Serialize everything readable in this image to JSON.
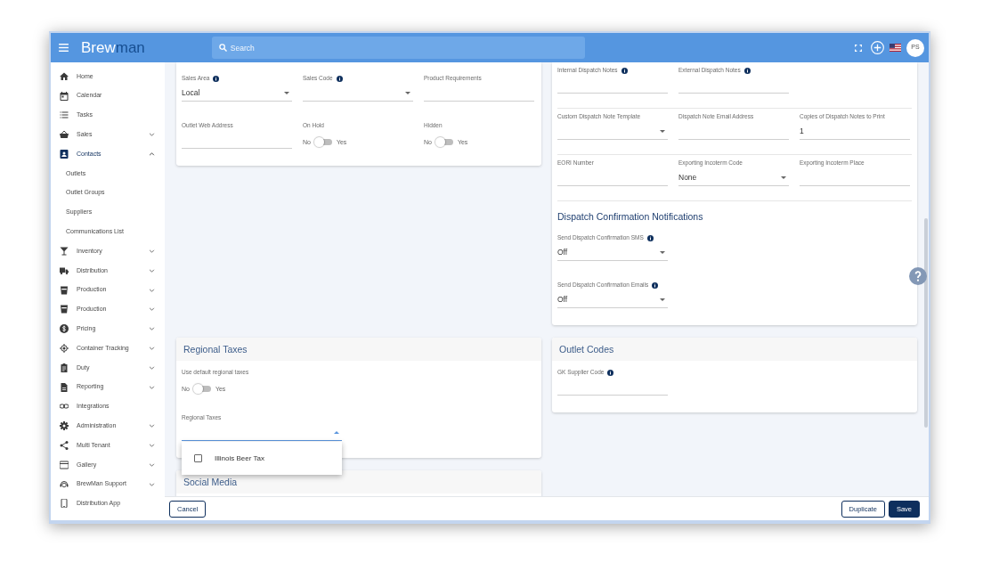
{
  "topbar": {
    "logo": {
      "part_1": "Brew",
      "part_2": "man"
    },
    "search": {
      "placeholder": "Search"
    },
    "avatar": "PS"
  },
  "sidebar": {
    "items": [
      {
        "label": "Home",
        "expandable": false,
        "selected": false
      },
      {
        "label": "Calendar",
        "expandable": false,
        "selected": false
      },
      {
        "label": "Tasks",
        "expandable": false,
        "selected": false
      },
      {
        "label": "Sales",
        "expandable": true,
        "expanded": false,
        "selected": false
      },
      {
        "label": "Contacts",
        "expandable": true,
        "expanded": true,
        "selected": true,
        "children": [
          {
            "label": "Outlets",
            "selected": false
          },
          {
            "label": "Outlet Groups",
            "selected": false
          },
          {
            "label": "Suppliers",
            "selected": false
          },
          {
            "label": "Communications List",
            "selected": false
          }
        ]
      },
      {
        "label": "Inventory",
        "expandable": true,
        "expanded": false,
        "selected": false
      },
      {
        "label": "Distribution",
        "expandable": true,
        "expanded": false,
        "selected": false
      },
      {
        "label": "Production",
        "expandable": true,
        "expanded": false,
        "selected": false
      },
      {
        "label": "Production",
        "expandable": true,
        "expanded": false,
        "selected": false
      },
      {
        "label": "Pricing",
        "expandable": true,
        "expanded": false,
        "selected": false
      },
      {
        "label": "Container Tracking",
        "expandable": true,
        "expanded": false,
        "selected": false
      },
      {
        "label": "Duty",
        "expandable": true,
        "expanded": false,
        "selected": false
      },
      {
        "label": "Reporting",
        "expandable": true,
        "expanded": false,
        "selected": false
      },
      {
        "label": "Integrations",
        "expandable": false,
        "selected": false
      },
      {
        "label": "Administration",
        "expandable": true,
        "expanded": false,
        "selected": false
      },
      {
        "label": "Multi Tenant",
        "expandable": true,
        "expanded": false,
        "selected": false
      },
      {
        "label": "Gallery",
        "expandable": true,
        "expanded": false,
        "selected": false
      },
      {
        "label": "BrewMan Support",
        "expandable": true,
        "expanded": false,
        "selected": false
      },
      {
        "label": "Distribution App",
        "expandable": false,
        "selected": false
      }
    ]
  },
  "form": {
    "left_column": [
      {
        "sections": [
          {
            "divided": false,
            "rows": [
              [
                {
                  "kind": "select",
                  "label": "Sales Area",
                  "info": true,
                  "value": "Local",
                  "open": false
                },
                {
                  "kind": "select",
                  "label": "Sales Code",
                  "info": true,
                  "open": false
                },
                {
                  "kind": "input",
                  "label": "Product Requirements",
                  "info": false
                }
              ],
              [
                {
                  "kind": "input",
                  "label": "Outlet Web Address",
                  "info": false
                },
                {
                  "kind": "toggle",
                  "label": "On Hold",
                  "info": false,
                  "off_label": "No",
                  "on_label": "Yes",
                  "on": false
                },
                {
                  "kind": "toggle",
                  "label": "Hidden",
                  "info": false,
                  "off_label": "No",
                  "on_label": "Yes",
                  "on": false
                }
              ]
            ]
          }
        ]
      },
      {
        "title": "Regional Taxes",
        "sections": [
          {
            "divided": false,
            "rows": [
              [
                {
                  "kind": "toggle",
                  "label": "Use default regional taxes",
                  "info": false,
                  "off_label": "No",
                  "on_label": "Yes",
                  "on": false
                }
              ],
              [
                {
                  "kind": "multiselect",
                  "label": "Regional Taxes",
                  "info": false,
                  "open": true,
                  "options": [
                    {
                      "label": "Illinois Beer Tax",
                      "checked": false
                    }
                  ]
                }
              ]
            ]
          }
        ]
      },
      {
        "title": "Social Media"
      }
    ],
    "right_column": [
      {
        "sections": [
          {
            "divided": true,
            "rows": [
              [
                {
                  "kind": "input",
                  "label": "Internal Dispatch Notes",
                  "info": true
                },
                {
                  "kind": "input",
                  "label": "External Dispatch Notes",
                  "info": true
                }
              ],
              [
                {
                  "kind": "select",
                  "label": "Custom Dispatch Note Template",
                  "info": false,
                  "open": false
                },
                {
                  "kind": "input",
                  "label": "Dispatch Note Email Address",
                  "info": false
                },
                {
                  "kind": "input",
                  "label": "Copies of Dispatch Notes to Print",
                  "info": false,
                  "value": "1"
                }
              ],
              [
                {
                  "kind": "input",
                  "label": "EORI Number",
                  "info": false
                },
                {
                  "kind": "select",
                  "label": "Exporting Incoterm Code",
                  "info": false,
                  "value": "None",
                  "open": false
                },
                {
                  "kind": "input",
                  "label": "Exporting Incoterm Place",
                  "info": false
                }
              ]
            ]
          },
          {
            "heading": "Dispatch Confirmation Notifications",
            "divided": false,
            "rows": [
              [
                {
                  "kind": "select",
                  "label": "Send Dispatch Confirmation SMS",
                  "info": true,
                  "value": "Off",
                  "open": false
                }
              ],
              [
                {
                  "kind": "select",
                  "label": "Send Dispatch Confirmation Emails",
                  "info": true,
                  "value": "Off",
                  "open": false
                }
              ]
            ]
          }
        ]
      },
      {
        "title": "Outlet Codes",
        "sections": [
          {
            "divided": false,
            "rows": [
              [
                {
                  "kind": "input",
                  "label": "GK Supplier Code",
                  "info": true
                }
              ]
            ]
          }
        ]
      }
    ]
  },
  "footer": {
    "start_buttons": [
      {
        "label": "Cancel",
        "primary": false
      }
    ],
    "end_buttons": [
      {
        "label": "Duplicate",
        "primary": false
      },
      {
        "label": "Save",
        "primary": true
      }
    ]
  }
}
